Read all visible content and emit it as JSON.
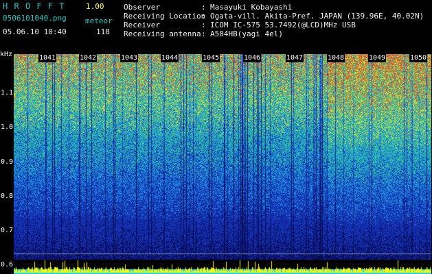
{
  "app": {
    "name": "H R O F F T",
    "version": "1.00",
    "filename": "0506101040.png",
    "meteor_label": "meteor",
    "datetime": "05.06.10 10:40",
    "meteor_count": "118"
  },
  "info": {
    "labels": [
      "Observer",
      "Receiving Location",
      "Receiver",
      "Receiving antenna"
    ],
    "values": [
      "Masayuki Kobayashi",
      "Ogata-vill. Akita-Pref. JAPAN (139.96E, 40.02N)",
      "ICOM IC-575 53.7492(@LCD)MHz USB",
      "A504HB(yagi 4el)"
    ]
  },
  "axis": {
    "unit": "kHz",
    "ticks": [
      "1.1",
      "1.0",
      "0.9",
      "0.8",
      "0.7",
      "0.6"
    ],
    "minutes": [
      "1041",
      "1042",
      "1043",
      "1044",
      "1045",
      "1046",
      "1047",
      "1048",
      "1049",
      "1050"
    ]
  },
  "colors": {
    "background": "#000000",
    "header_cyan": "#29c3c3",
    "header_white": "#f2f2f2",
    "echo_yellow": "#ffff00",
    "noise_blue": "#1a2a9a",
    "noise_cyan": "#22c0d0"
  }
}
